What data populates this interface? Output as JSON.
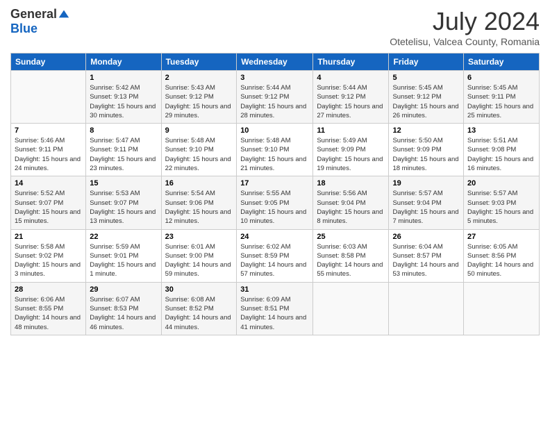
{
  "header": {
    "logo_general": "General",
    "logo_blue": "Blue",
    "month_title": "July 2024",
    "subtitle": "Otetelisu, Valcea County, Romania"
  },
  "days_of_week": [
    "Sunday",
    "Monday",
    "Tuesday",
    "Wednesday",
    "Thursday",
    "Friday",
    "Saturday"
  ],
  "weeks": [
    [
      {
        "day": "",
        "sunrise": "",
        "sunset": "",
        "daylight": ""
      },
      {
        "day": "1",
        "sunrise": "Sunrise: 5:42 AM",
        "sunset": "Sunset: 9:13 PM",
        "daylight": "Daylight: 15 hours and 30 minutes."
      },
      {
        "day": "2",
        "sunrise": "Sunrise: 5:43 AM",
        "sunset": "Sunset: 9:12 PM",
        "daylight": "Daylight: 15 hours and 29 minutes."
      },
      {
        "day": "3",
        "sunrise": "Sunrise: 5:44 AM",
        "sunset": "Sunset: 9:12 PM",
        "daylight": "Daylight: 15 hours and 28 minutes."
      },
      {
        "day": "4",
        "sunrise": "Sunrise: 5:44 AM",
        "sunset": "Sunset: 9:12 PM",
        "daylight": "Daylight: 15 hours and 27 minutes."
      },
      {
        "day": "5",
        "sunrise": "Sunrise: 5:45 AM",
        "sunset": "Sunset: 9:12 PM",
        "daylight": "Daylight: 15 hours and 26 minutes."
      },
      {
        "day": "6",
        "sunrise": "Sunrise: 5:45 AM",
        "sunset": "Sunset: 9:11 PM",
        "daylight": "Daylight: 15 hours and 25 minutes."
      }
    ],
    [
      {
        "day": "7",
        "sunrise": "Sunrise: 5:46 AM",
        "sunset": "Sunset: 9:11 PM",
        "daylight": "Daylight: 15 hours and 24 minutes."
      },
      {
        "day": "8",
        "sunrise": "Sunrise: 5:47 AM",
        "sunset": "Sunset: 9:11 PM",
        "daylight": "Daylight: 15 hours and 23 minutes."
      },
      {
        "day": "9",
        "sunrise": "Sunrise: 5:48 AM",
        "sunset": "Sunset: 9:10 PM",
        "daylight": "Daylight: 15 hours and 22 minutes."
      },
      {
        "day": "10",
        "sunrise": "Sunrise: 5:48 AM",
        "sunset": "Sunset: 9:10 PM",
        "daylight": "Daylight: 15 hours and 21 minutes."
      },
      {
        "day": "11",
        "sunrise": "Sunrise: 5:49 AM",
        "sunset": "Sunset: 9:09 PM",
        "daylight": "Daylight: 15 hours and 19 minutes."
      },
      {
        "day": "12",
        "sunrise": "Sunrise: 5:50 AM",
        "sunset": "Sunset: 9:09 PM",
        "daylight": "Daylight: 15 hours and 18 minutes."
      },
      {
        "day": "13",
        "sunrise": "Sunrise: 5:51 AM",
        "sunset": "Sunset: 9:08 PM",
        "daylight": "Daylight: 15 hours and 16 minutes."
      }
    ],
    [
      {
        "day": "14",
        "sunrise": "Sunrise: 5:52 AM",
        "sunset": "Sunset: 9:07 PM",
        "daylight": "Daylight: 15 hours and 15 minutes."
      },
      {
        "day": "15",
        "sunrise": "Sunrise: 5:53 AM",
        "sunset": "Sunset: 9:07 PM",
        "daylight": "Daylight: 15 hours and 13 minutes."
      },
      {
        "day": "16",
        "sunrise": "Sunrise: 5:54 AM",
        "sunset": "Sunset: 9:06 PM",
        "daylight": "Daylight: 15 hours and 12 minutes."
      },
      {
        "day": "17",
        "sunrise": "Sunrise: 5:55 AM",
        "sunset": "Sunset: 9:05 PM",
        "daylight": "Daylight: 15 hours and 10 minutes."
      },
      {
        "day": "18",
        "sunrise": "Sunrise: 5:56 AM",
        "sunset": "Sunset: 9:04 PM",
        "daylight": "Daylight: 15 hours and 8 minutes."
      },
      {
        "day": "19",
        "sunrise": "Sunrise: 5:57 AM",
        "sunset": "Sunset: 9:04 PM",
        "daylight": "Daylight: 15 hours and 7 minutes."
      },
      {
        "day": "20",
        "sunrise": "Sunrise: 5:57 AM",
        "sunset": "Sunset: 9:03 PM",
        "daylight": "Daylight: 15 hours and 5 minutes."
      }
    ],
    [
      {
        "day": "21",
        "sunrise": "Sunrise: 5:58 AM",
        "sunset": "Sunset: 9:02 PM",
        "daylight": "Daylight: 15 hours and 3 minutes."
      },
      {
        "day": "22",
        "sunrise": "Sunrise: 5:59 AM",
        "sunset": "Sunset: 9:01 PM",
        "daylight": "Daylight: 15 hours and 1 minute."
      },
      {
        "day": "23",
        "sunrise": "Sunrise: 6:01 AM",
        "sunset": "Sunset: 9:00 PM",
        "daylight": "Daylight: 14 hours and 59 minutes."
      },
      {
        "day": "24",
        "sunrise": "Sunrise: 6:02 AM",
        "sunset": "Sunset: 8:59 PM",
        "daylight": "Daylight: 14 hours and 57 minutes."
      },
      {
        "day": "25",
        "sunrise": "Sunrise: 6:03 AM",
        "sunset": "Sunset: 8:58 PM",
        "daylight": "Daylight: 14 hours and 55 minutes."
      },
      {
        "day": "26",
        "sunrise": "Sunrise: 6:04 AM",
        "sunset": "Sunset: 8:57 PM",
        "daylight": "Daylight: 14 hours and 53 minutes."
      },
      {
        "day": "27",
        "sunrise": "Sunrise: 6:05 AM",
        "sunset": "Sunset: 8:56 PM",
        "daylight": "Daylight: 14 hours and 50 minutes."
      }
    ],
    [
      {
        "day": "28",
        "sunrise": "Sunrise: 6:06 AM",
        "sunset": "Sunset: 8:55 PM",
        "daylight": "Daylight: 14 hours and 48 minutes."
      },
      {
        "day": "29",
        "sunrise": "Sunrise: 6:07 AM",
        "sunset": "Sunset: 8:53 PM",
        "daylight": "Daylight: 14 hours and 46 minutes."
      },
      {
        "day": "30",
        "sunrise": "Sunrise: 6:08 AM",
        "sunset": "Sunset: 8:52 PM",
        "daylight": "Daylight: 14 hours and 44 minutes."
      },
      {
        "day": "31",
        "sunrise": "Sunrise: 6:09 AM",
        "sunset": "Sunset: 8:51 PM",
        "daylight": "Daylight: 14 hours and 41 minutes."
      },
      {
        "day": "",
        "sunrise": "",
        "sunset": "",
        "daylight": ""
      },
      {
        "day": "",
        "sunrise": "",
        "sunset": "",
        "daylight": ""
      },
      {
        "day": "",
        "sunrise": "",
        "sunset": "",
        "daylight": ""
      }
    ]
  ]
}
